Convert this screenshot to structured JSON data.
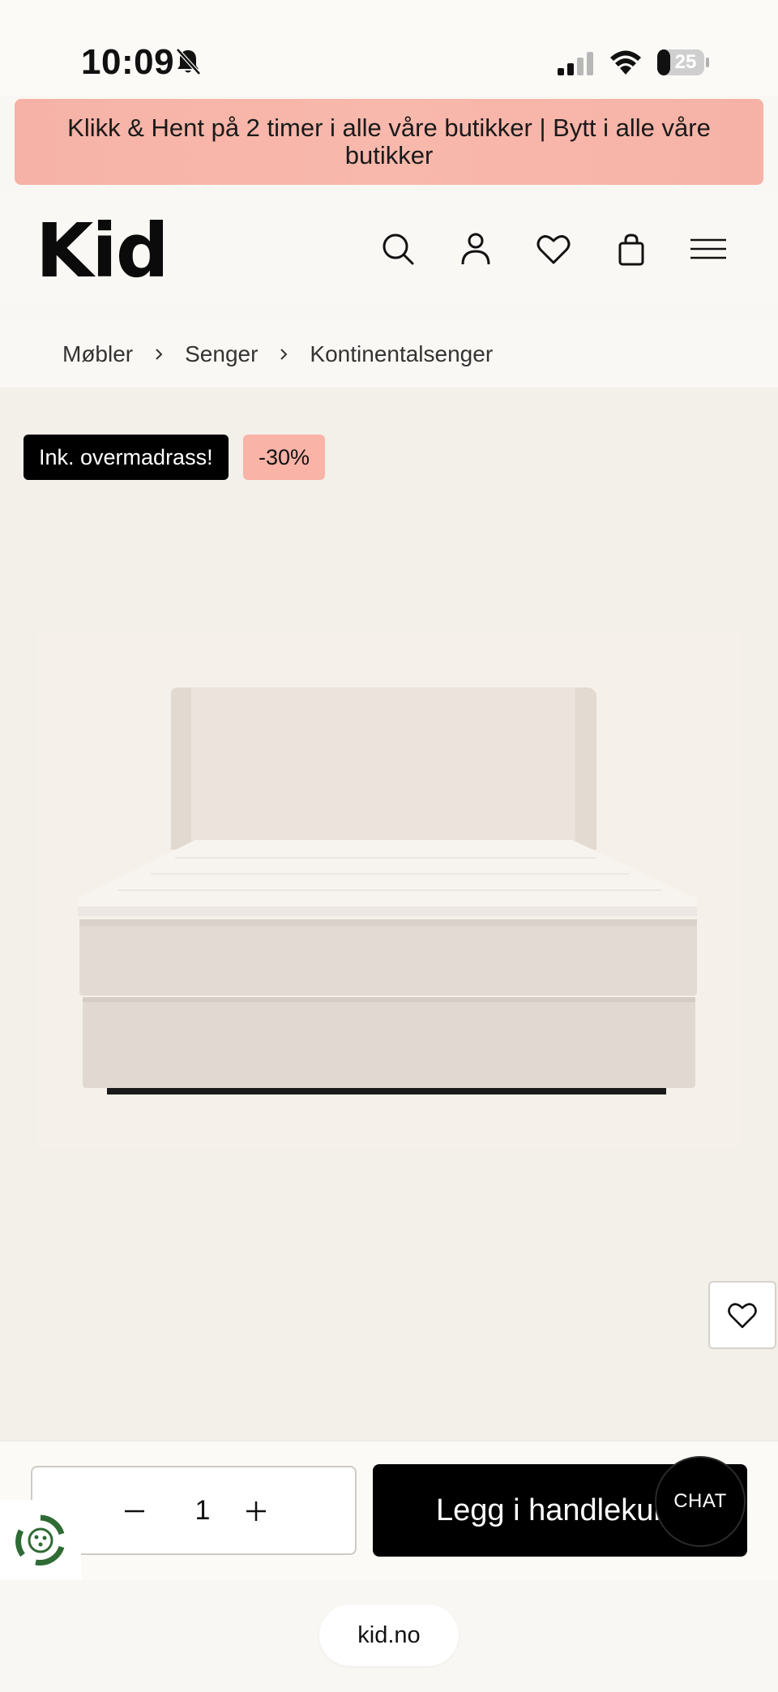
{
  "status_bar": {
    "time": "10:09",
    "battery": "25"
  },
  "promo": {
    "text": "Klikk & Hent på 2 timer i alle våre butikker | Bytt i alle våre butikker"
  },
  "header": {
    "logo": "Kid",
    "icons": [
      "search-icon",
      "account-icon",
      "heart-icon",
      "bag-icon",
      "menu-icon"
    ]
  },
  "breadcrumb": {
    "items": [
      "Møbler",
      "Senger",
      "Kontinentalsenger"
    ]
  },
  "product": {
    "badges": {
      "feature": "Ink. overmadrass!",
      "discount": "-30%"
    },
    "image_subject": "continental-bed"
  },
  "purchase": {
    "quantity": "1",
    "add_to_cart": "Legg i handlekurv",
    "chat": "CHAT"
  },
  "browser": {
    "url": "kid.no"
  },
  "colors": {
    "promo_bg": "#f9b8ac",
    "discount_badge": "#f9b3a7",
    "product_bg": "#f3efe9",
    "button_dark": "#000000"
  }
}
